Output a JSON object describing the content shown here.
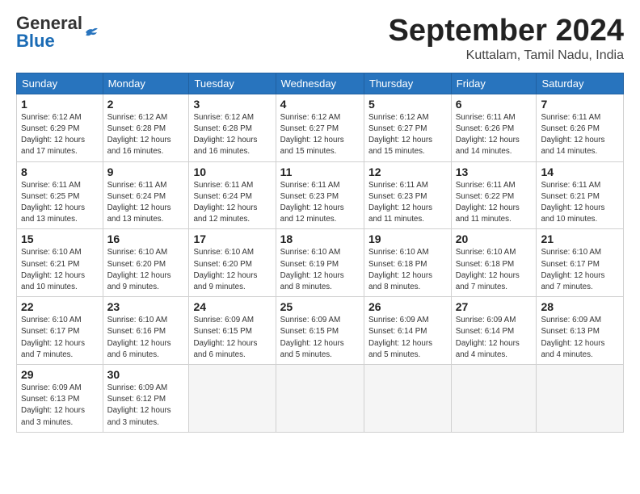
{
  "logo": {
    "general": "General",
    "blue": "Blue"
  },
  "title": "September 2024",
  "location": "Kuttalam, Tamil Nadu, India",
  "days_of_week": [
    "Sunday",
    "Monday",
    "Tuesday",
    "Wednesday",
    "Thursday",
    "Friday",
    "Saturday"
  ],
  "weeks": [
    [
      {
        "day": 1,
        "info": "Sunrise: 6:12 AM\nSunset: 6:29 PM\nDaylight: 12 hours\nand 17 minutes."
      },
      {
        "day": 2,
        "info": "Sunrise: 6:12 AM\nSunset: 6:28 PM\nDaylight: 12 hours\nand 16 minutes."
      },
      {
        "day": 3,
        "info": "Sunrise: 6:12 AM\nSunset: 6:28 PM\nDaylight: 12 hours\nand 16 minutes."
      },
      {
        "day": 4,
        "info": "Sunrise: 6:12 AM\nSunset: 6:27 PM\nDaylight: 12 hours\nand 15 minutes."
      },
      {
        "day": 5,
        "info": "Sunrise: 6:12 AM\nSunset: 6:27 PM\nDaylight: 12 hours\nand 15 minutes."
      },
      {
        "day": 6,
        "info": "Sunrise: 6:11 AM\nSunset: 6:26 PM\nDaylight: 12 hours\nand 14 minutes."
      },
      {
        "day": 7,
        "info": "Sunrise: 6:11 AM\nSunset: 6:26 PM\nDaylight: 12 hours\nand 14 minutes."
      }
    ],
    [
      {
        "day": 8,
        "info": "Sunrise: 6:11 AM\nSunset: 6:25 PM\nDaylight: 12 hours\nand 13 minutes."
      },
      {
        "day": 9,
        "info": "Sunrise: 6:11 AM\nSunset: 6:24 PM\nDaylight: 12 hours\nand 13 minutes."
      },
      {
        "day": 10,
        "info": "Sunrise: 6:11 AM\nSunset: 6:24 PM\nDaylight: 12 hours\nand 12 minutes."
      },
      {
        "day": 11,
        "info": "Sunrise: 6:11 AM\nSunset: 6:23 PM\nDaylight: 12 hours\nand 12 minutes."
      },
      {
        "day": 12,
        "info": "Sunrise: 6:11 AM\nSunset: 6:23 PM\nDaylight: 12 hours\nand 11 minutes."
      },
      {
        "day": 13,
        "info": "Sunrise: 6:11 AM\nSunset: 6:22 PM\nDaylight: 12 hours\nand 11 minutes."
      },
      {
        "day": 14,
        "info": "Sunrise: 6:11 AM\nSunset: 6:21 PM\nDaylight: 12 hours\nand 10 minutes."
      }
    ],
    [
      {
        "day": 15,
        "info": "Sunrise: 6:10 AM\nSunset: 6:21 PM\nDaylight: 12 hours\nand 10 minutes."
      },
      {
        "day": 16,
        "info": "Sunrise: 6:10 AM\nSunset: 6:20 PM\nDaylight: 12 hours\nand 9 minutes."
      },
      {
        "day": 17,
        "info": "Sunrise: 6:10 AM\nSunset: 6:20 PM\nDaylight: 12 hours\nand 9 minutes."
      },
      {
        "day": 18,
        "info": "Sunrise: 6:10 AM\nSunset: 6:19 PM\nDaylight: 12 hours\nand 8 minutes."
      },
      {
        "day": 19,
        "info": "Sunrise: 6:10 AM\nSunset: 6:18 PM\nDaylight: 12 hours\nand 8 minutes."
      },
      {
        "day": 20,
        "info": "Sunrise: 6:10 AM\nSunset: 6:18 PM\nDaylight: 12 hours\nand 7 minutes."
      },
      {
        "day": 21,
        "info": "Sunrise: 6:10 AM\nSunset: 6:17 PM\nDaylight: 12 hours\nand 7 minutes."
      }
    ],
    [
      {
        "day": 22,
        "info": "Sunrise: 6:10 AM\nSunset: 6:17 PM\nDaylight: 12 hours\nand 7 minutes."
      },
      {
        "day": 23,
        "info": "Sunrise: 6:10 AM\nSunset: 6:16 PM\nDaylight: 12 hours\nand 6 minutes."
      },
      {
        "day": 24,
        "info": "Sunrise: 6:09 AM\nSunset: 6:15 PM\nDaylight: 12 hours\nand 6 minutes."
      },
      {
        "day": 25,
        "info": "Sunrise: 6:09 AM\nSunset: 6:15 PM\nDaylight: 12 hours\nand 5 minutes."
      },
      {
        "day": 26,
        "info": "Sunrise: 6:09 AM\nSunset: 6:14 PM\nDaylight: 12 hours\nand 5 minutes."
      },
      {
        "day": 27,
        "info": "Sunrise: 6:09 AM\nSunset: 6:14 PM\nDaylight: 12 hours\nand 4 minutes."
      },
      {
        "day": 28,
        "info": "Sunrise: 6:09 AM\nSunset: 6:13 PM\nDaylight: 12 hours\nand 4 minutes."
      }
    ],
    [
      {
        "day": 29,
        "info": "Sunrise: 6:09 AM\nSunset: 6:13 PM\nDaylight: 12 hours\nand 3 minutes."
      },
      {
        "day": 30,
        "info": "Sunrise: 6:09 AM\nSunset: 6:12 PM\nDaylight: 12 hours\nand 3 minutes."
      },
      null,
      null,
      null,
      null,
      null
    ]
  ]
}
